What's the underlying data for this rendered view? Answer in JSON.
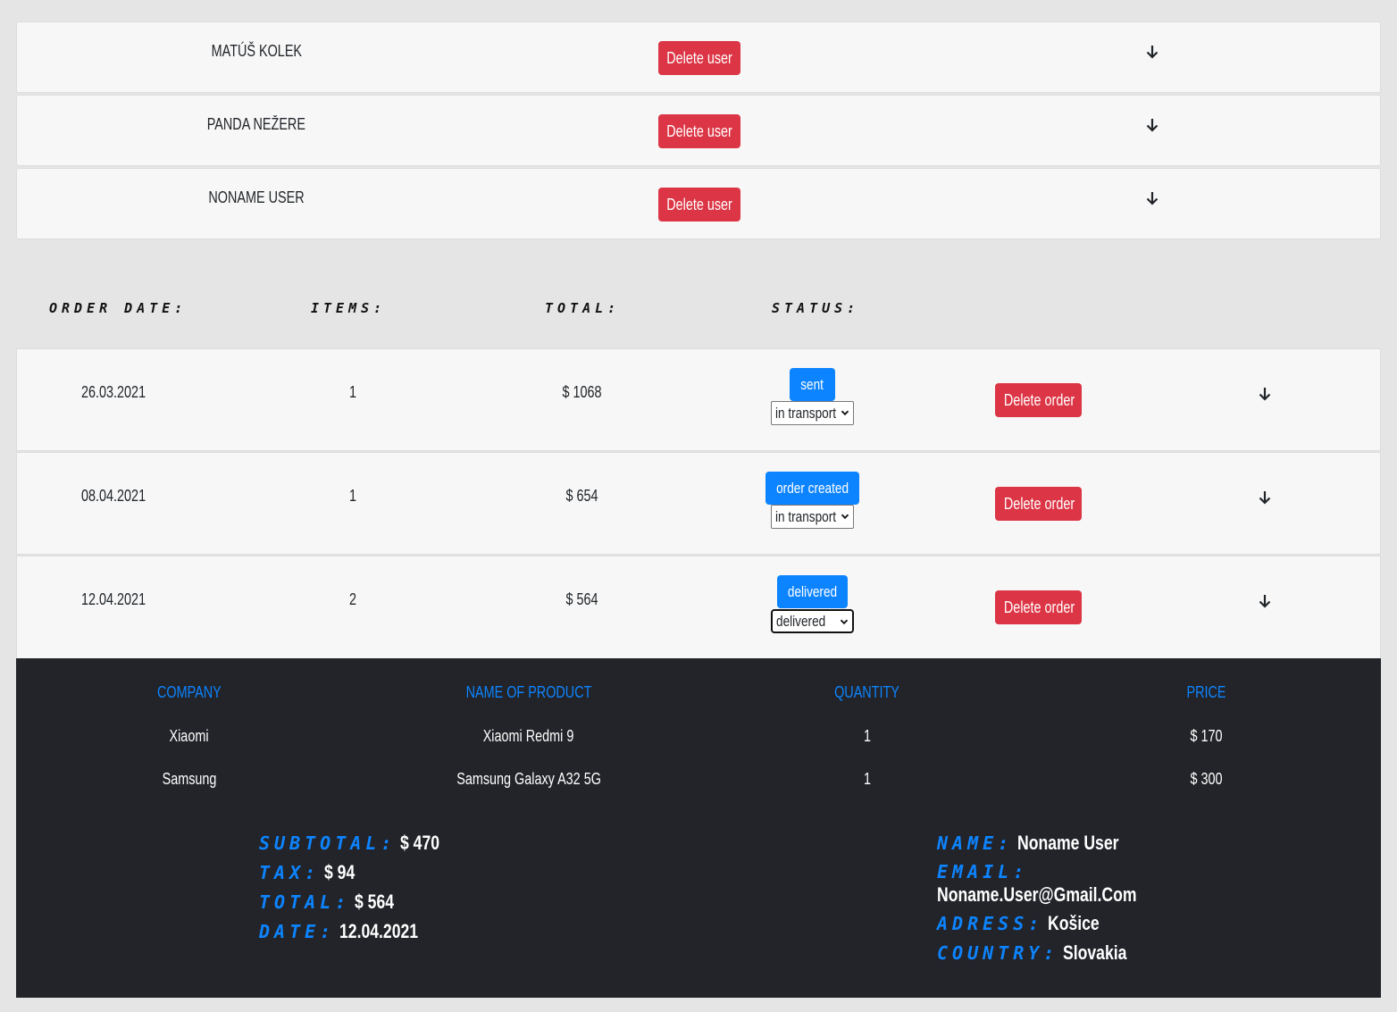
{
  "users": [
    {
      "name": "MATÚŠ KOLEK",
      "delete_label": "Delete user"
    },
    {
      "name": "PANDA NEŽERE",
      "delete_label": "Delete user"
    },
    {
      "name": "NONAME USER",
      "delete_label": "Delete user"
    }
  ],
  "order_header": {
    "date": "ORDER DATE:",
    "items": "ITEMS:",
    "total": "TOTAL:",
    "status": "STATUS:"
  },
  "orders": [
    {
      "date": "26.03.2021",
      "items": "1",
      "total": "$ 1068",
      "status": "sent",
      "select": "in transport",
      "delete_label": "Delete order"
    },
    {
      "date": "08.04.2021",
      "items": "1",
      "total": "$ 654",
      "status": "order created",
      "select": "in transport",
      "delete_label": "Delete order"
    },
    {
      "date": "12.04.2021",
      "items": "2",
      "total": "$ 564",
      "status": "delivered",
      "select": "delivered",
      "delete_label": "Delete order"
    }
  ],
  "detail": {
    "columns": [
      "COMPANY",
      "NAME OF PRODUCT",
      "QUANTITY",
      "PRICE"
    ],
    "rows": [
      [
        "Xiaomi",
        "Xiaomi Redmi 9",
        "1",
        "$ 170"
      ],
      [
        "Samsung",
        "Samsung Galaxy A32 5G",
        "1",
        "$ 300"
      ]
    ],
    "summary": {
      "subtotal_label": "SUBTOTAL:",
      "subtotal": "$ 470",
      "tax_label": "TAX:",
      "tax": "$ 94",
      "total_label": "TOTAL:",
      "total": "$ 564",
      "date_label": "DATE:",
      "date": "12.04.2021"
    },
    "customer": {
      "name_label": "NAME:",
      "name": "Noname User",
      "email_label": "EMAIL:",
      "email": "Noname.User@Gmail.Com",
      "address_label": "ADRESS:",
      "address": "Košice",
      "country_label": "COUNTRY:",
      "country": "Slovakia"
    }
  },
  "colors": {
    "danger": "#dc3545",
    "primary": "#0d84ff",
    "dark_panel": "#222429",
    "background": "#e5e5e5"
  },
  "icons": {
    "expand": "arrow-down-icon",
    "select": "chevron-down-icon"
  }
}
